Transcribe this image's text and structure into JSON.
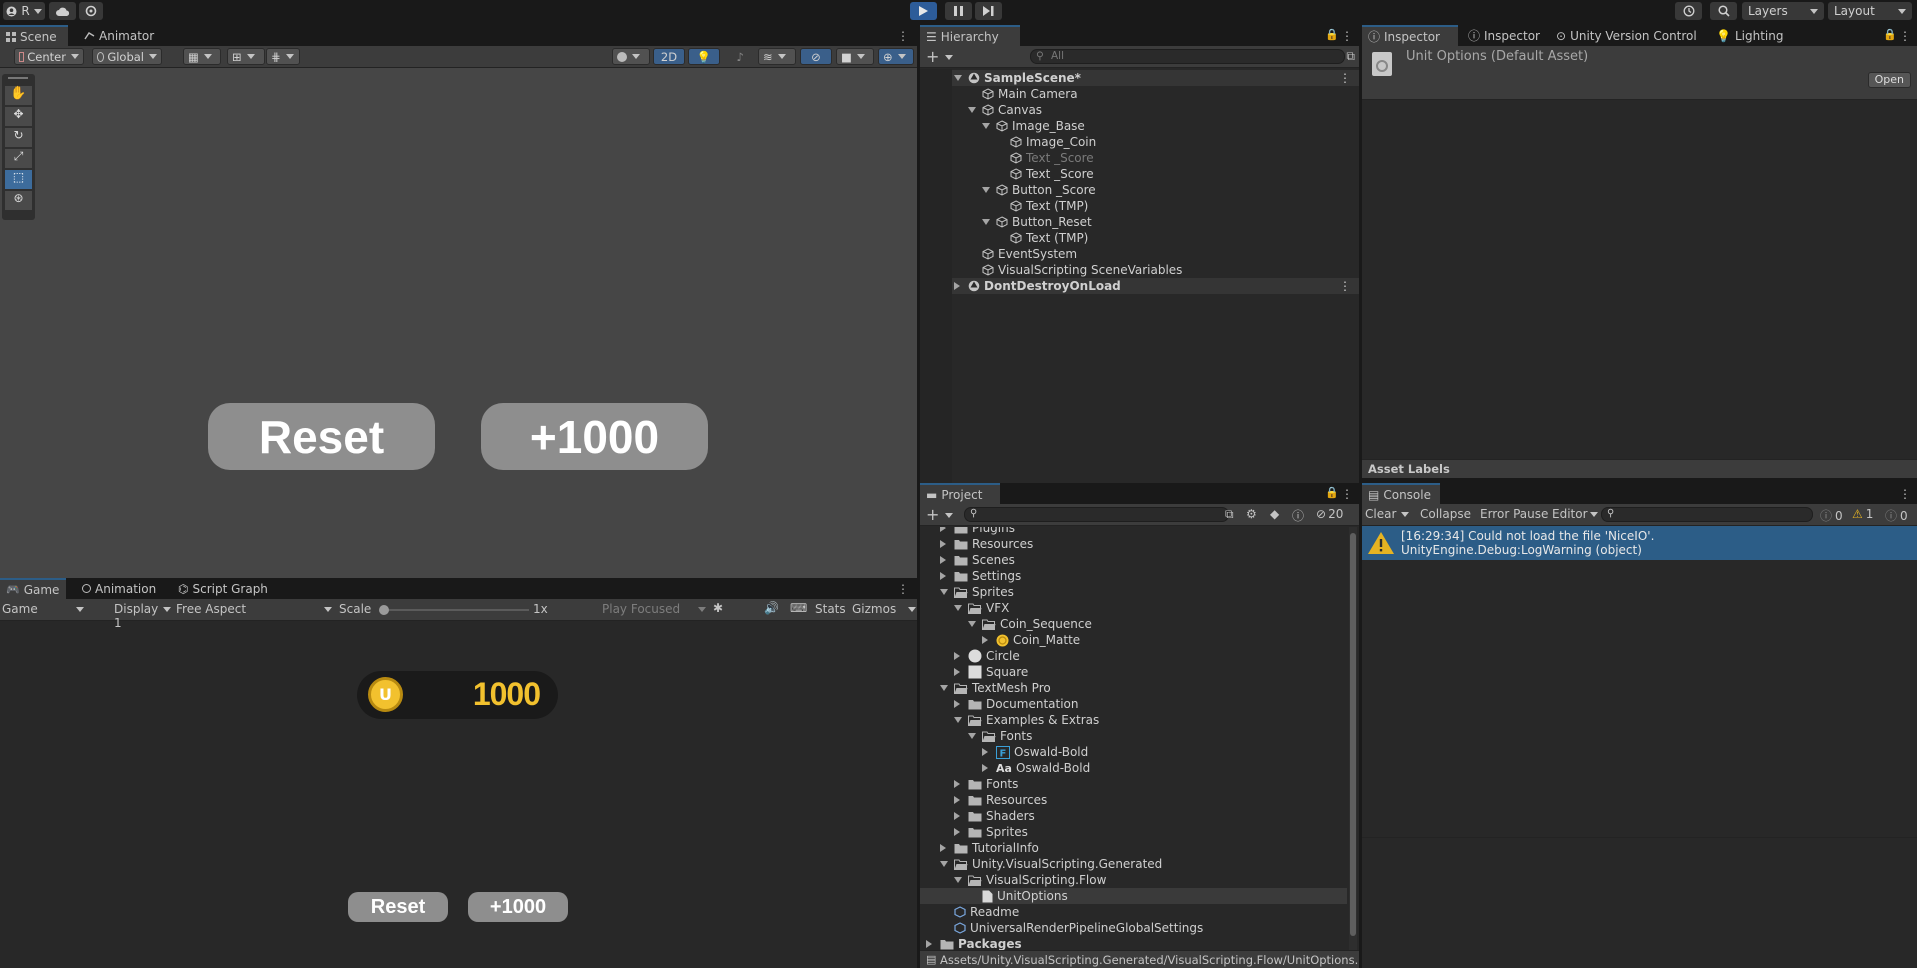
{
  "toolbar": {
    "account": "R",
    "layers": "Layers",
    "layout": "Layout"
  },
  "scene": {
    "tabs": [
      "Scene",
      "Animator"
    ],
    "pivot": "Center",
    "space": "Global",
    "mode_2d": "2D",
    "buttons": {
      "reset": "Reset",
      "plus": "+1000"
    }
  },
  "game": {
    "tabs": [
      "Game",
      "Animation",
      "Script Graph"
    ],
    "view": "Game",
    "display": "Display 1",
    "aspect": "Free Aspect",
    "scale_label": "Scale",
    "scale_value": "1x",
    "play_focused": "Play Focused",
    "stats": "Stats",
    "gizmos": "Gizmos",
    "score": "1000",
    "coin_text": "U",
    "reset": "Reset",
    "plus": "+1000"
  },
  "hierarchy": {
    "tab": "Hierarchy",
    "search_placeholder": "All",
    "items": [
      {
        "label": "SampleScene*",
        "depth": 0,
        "arrow": "d",
        "kind": "scene"
      },
      {
        "label": "Main Camera",
        "depth": 1,
        "arrow": "",
        "kind": "obj"
      },
      {
        "label": "Canvas",
        "depth": 1,
        "arrow": "d",
        "kind": "obj"
      },
      {
        "label": "Image_Base",
        "depth": 2,
        "arrow": "d",
        "kind": "obj"
      },
      {
        "label": "Image_Coin",
        "depth": 3,
        "arrow": "",
        "kind": "obj"
      },
      {
        "label": "Text _Score",
        "depth": 3,
        "arrow": "",
        "kind": "obj",
        "dim": true
      },
      {
        "label": "Text _Score",
        "depth": 3,
        "arrow": "",
        "kind": "obj"
      },
      {
        "label": "Button _Score",
        "depth": 2,
        "arrow": "d",
        "kind": "obj"
      },
      {
        "label": "Text (TMP)",
        "depth": 3,
        "arrow": "",
        "kind": "obj"
      },
      {
        "label": "Button_Reset",
        "depth": 2,
        "arrow": "d",
        "kind": "obj"
      },
      {
        "label": "Text (TMP)",
        "depth": 3,
        "arrow": "",
        "kind": "obj"
      },
      {
        "label": "EventSystem",
        "depth": 1,
        "arrow": "",
        "kind": "obj"
      },
      {
        "label": "VisualScripting SceneVariables",
        "depth": 1,
        "arrow": "",
        "kind": "obj"
      },
      {
        "label": "DontDestroyOnLoad",
        "depth": 0,
        "arrow": "r",
        "kind": "scene"
      }
    ]
  },
  "inspector": {
    "tabs": [
      "Inspector",
      "Inspector",
      "Unity Version Control",
      "Lighting"
    ],
    "asset_title": "Unit Options (Default Asset)",
    "open_button": "Open",
    "asset_labels": "Asset Labels"
  },
  "project": {
    "tab": "Project",
    "hidden_count": "20",
    "items": [
      {
        "label": "Plugins",
        "depth": 1,
        "arrow": "r",
        "kind": "folder"
      },
      {
        "label": "Resources",
        "depth": 1,
        "arrow": "r",
        "kind": "folder"
      },
      {
        "label": "Scenes",
        "depth": 1,
        "arrow": "r",
        "kind": "folder"
      },
      {
        "label": "Settings",
        "depth": 1,
        "arrow": "r",
        "kind": "folder"
      },
      {
        "label": "Sprites",
        "depth": 1,
        "arrow": "d",
        "kind": "folder-open"
      },
      {
        "label": "VFX",
        "depth": 2,
        "arrow": "d",
        "kind": "folder-open"
      },
      {
        "label": "Coin_Sequence",
        "depth": 3,
        "arrow": "d",
        "kind": "folder-open"
      },
      {
        "label": "Coin_Matte",
        "depth": 4,
        "arrow": "r",
        "kind": "coin"
      },
      {
        "label": "Circle",
        "depth": 2,
        "arrow": "r",
        "kind": "circle"
      },
      {
        "label": "Square",
        "depth": 2,
        "arrow": "r",
        "kind": "square"
      },
      {
        "label": "TextMesh Pro",
        "depth": 1,
        "arrow": "d",
        "kind": "folder-open"
      },
      {
        "label": "Documentation",
        "depth": 2,
        "arrow": "r",
        "kind": "folder"
      },
      {
        "label": "Examples & Extras",
        "depth": 2,
        "arrow": "d",
        "kind": "folder-open"
      },
      {
        "label": "Fonts",
        "depth": 3,
        "arrow": "d",
        "kind": "folder-open"
      },
      {
        "label": "Oswald-Bold",
        "depth": 4,
        "arrow": "r",
        "kind": "font-f"
      },
      {
        "label": "Oswald-Bold",
        "depth": 4,
        "arrow": "r",
        "kind": "font-aa"
      },
      {
        "label": "Fonts",
        "depth": 2,
        "arrow": "r",
        "kind": "folder"
      },
      {
        "label": "Resources",
        "depth": 2,
        "arrow": "r",
        "kind": "folder"
      },
      {
        "label": "Shaders",
        "depth": 2,
        "arrow": "r",
        "kind": "folder"
      },
      {
        "label": "Sprites",
        "depth": 2,
        "arrow": "r",
        "kind": "folder"
      },
      {
        "label": "TutorialInfo",
        "depth": 1,
        "arrow": "r",
        "kind": "folder"
      },
      {
        "label": "Unity.VisualScripting.Generated",
        "depth": 1,
        "arrow": "d",
        "kind": "folder-open"
      },
      {
        "label": "VisualScripting.Flow",
        "depth": 2,
        "arrow": "d",
        "kind": "folder-open"
      },
      {
        "label": "UnitOptions",
        "depth": 3,
        "arrow": "",
        "kind": "file",
        "selected": true
      },
      {
        "label": "Readme",
        "depth": 1,
        "arrow": "",
        "kind": "asset"
      },
      {
        "label": "UniversalRenderPipelineGlobalSettings",
        "depth": 1,
        "arrow": "",
        "kind": "asset"
      },
      {
        "label": "Packages",
        "depth": 0,
        "arrow": "r",
        "kind": "folder",
        "bold": true
      }
    ],
    "path": "Assets/Unity.VisualScripting.Generated/VisualScripting.Flow/UnitOptions.asset"
  },
  "console": {
    "tab": "Console",
    "clear": "Clear",
    "collapse": "Collapse",
    "error_pause": "Error Pause",
    "editor": "Editor",
    "count_info": "0",
    "count_warn": "1",
    "count_error": "0",
    "message_line1": "[16:29:34] Could not load the file 'NiceIO'.",
    "message_line2": "UnityEngine.Debug:LogWarning (object)"
  },
  "colors": {
    "accent": "#2c5d87",
    "selection": "#2c5d87",
    "play": "#2d5c99",
    "coin_gold": "#f2c12e"
  }
}
